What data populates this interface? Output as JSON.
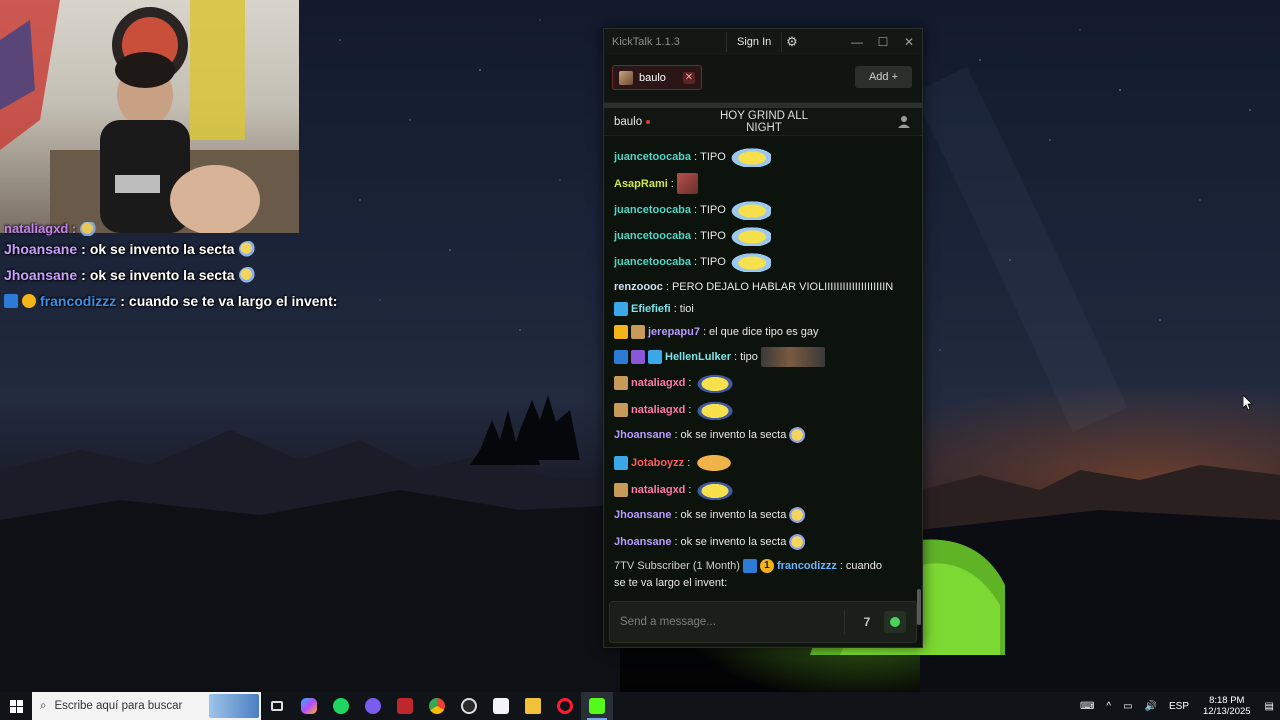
{
  "overlay_chat": {
    "cut_line": "nataliagxd :",
    "lines": [
      {
        "user": "Jhoansane",
        "sep": " : ",
        "message": "ok se invento la secta"
      },
      {
        "user": "Jhoansane",
        "sep": " : ",
        "message": "ok se invento la secta"
      },
      {
        "user": "francodizzz",
        "sep": " : ",
        "message": "cuando se te va largo el invent:"
      }
    ]
  },
  "window": {
    "app_title": "KickTalk 1.1.3",
    "sign_in_label": "Sign In",
    "settings_icon": "gear-icon",
    "minimize_icon": "—",
    "maximize_icon": "☐",
    "close_icon": "✕"
  },
  "tabs": [
    {
      "label": "baulo",
      "close_icon": "✕"
    }
  ],
  "add_button": {
    "label": "Add",
    "icon": "+"
  },
  "chat_header": {
    "channel": "baulo",
    "stream_title": "HOY GRIND ALL NIGHT"
  },
  "messages": [
    {
      "user": "juancetoocaba",
      "sep": ": ",
      "text": "TIPO"
    },
    {
      "user": "AsapRami",
      "sep": ": ",
      "text": ""
    },
    {
      "user": "juancetoocaba",
      "sep": ": ",
      "text": "TIPO"
    },
    {
      "user": "juancetoocaba",
      "sep": ": ",
      "text": "TIPO"
    },
    {
      "user": "juancetoocaba",
      "sep": ": ",
      "text": "TIPO"
    },
    {
      "user": "renzoooc",
      "sep": ": ",
      "text": "PERO DEJALO HABLAR VIOLIIIIIIIIIIIIIIIIIIIIN"
    },
    {
      "user": "Efiefiefi",
      "sep": ": ",
      "text": "tioi"
    },
    {
      "user": "jerepapu7",
      "sep": ": ",
      "text": "el que dice tipo es gay"
    },
    {
      "user": "HellenLulker",
      "sep": ": ",
      "text": "tipo"
    },
    {
      "user": "nataliagxd",
      "sep": ": ",
      "text": ""
    },
    {
      "user": "nataliagxd",
      "sep": ": ",
      "text": ""
    },
    {
      "user": "Jhoansane",
      "sep": ": ",
      "text": "ok se invento la secta"
    },
    {
      "user": "Jotaboyzz",
      "sep": ": ",
      "text": ""
    },
    {
      "user": "nataliagxd",
      "sep": ": ",
      "text": ""
    },
    {
      "user": "Jhoansane",
      "sep": ": ",
      "text": "ok se invento la secta"
    },
    {
      "user": "Jhoansane",
      "sep": ": ",
      "text": "ok se invento la secta"
    },
    {
      "badge_text": "7TV Subscriber (1 Month)",
      "user": "francodizzz",
      "sep": ": ",
      "text": "cuando",
      "text2": "se te va largo el invent:"
    }
  ],
  "input": {
    "placeholder": "Send a message..."
  },
  "taskbar": {
    "search_placeholder": "Escribe aquí para buscar",
    "language": "ESP",
    "time": "8:18 PM",
    "date": "12/13/2025"
  },
  "colors": {
    "kick_green": "#53fc18",
    "window_bg": "#0d120d",
    "tab_border": "#6e2a2a"
  }
}
